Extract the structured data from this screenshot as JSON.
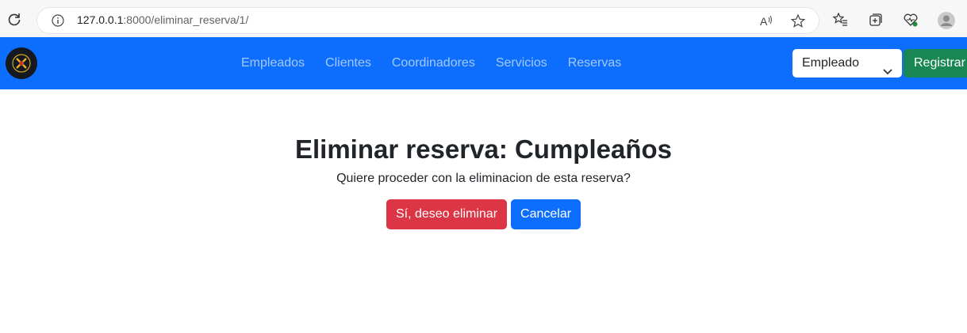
{
  "browser": {
    "url_host": "127.0.0.1",
    "url_path": ":8000/eliminar_reserva/1/"
  },
  "navbar": {
    "links": [
      "Empleados",
      "Clientes",
      "Coordinadores",
      "Servicios",
      "Reservas"
    ],
    "role_select_value": "Empleado",
    "register_label": "Registrar"
  },
  "main": {
    "title": "Eliminar reserva: Cumpleaños",
    "message": "Quiere proceder con la eliminacion de esta reserva?",
    "confirm_label": "Sí, deseo eliminar",
    "cancel_label": "Cancelar"
  },
  "colors": {
    "navbar": "#0d6efd",
    "danger": "#dc3545",
    "primary": "#0d6efd",
    "success": "#198754"
  }
}
